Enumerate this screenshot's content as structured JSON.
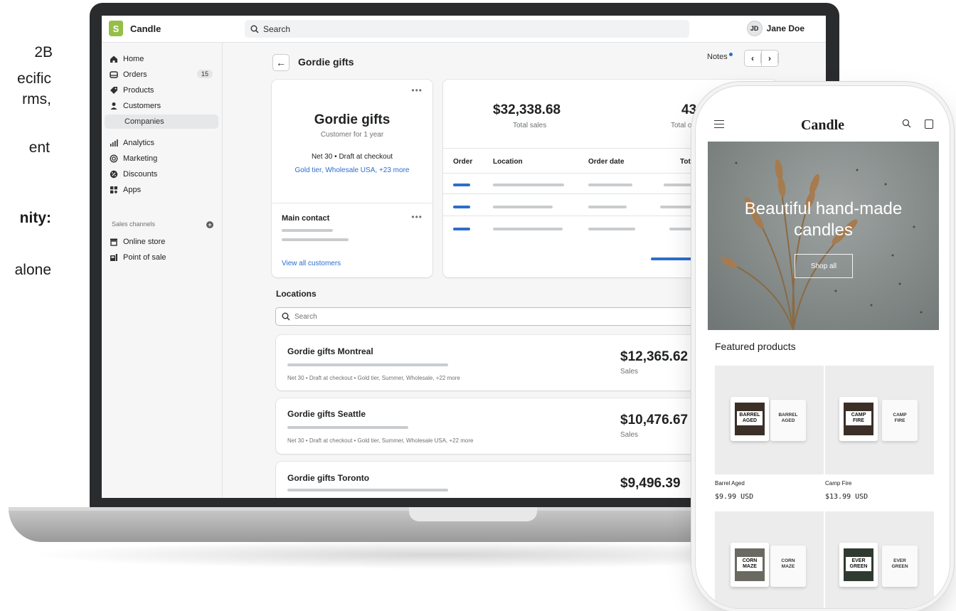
{
  "side_copy": {
    "line1": "2B",
    "line2": "ecific",
    "line3": "rms,",
    "line4": "ent",
    "line5": "nity:",
    "line6": "alone"
  },
  "app": {
    "brand": "Candle",
    "search_placeholder": "Search",
    "user_initials": "JD",
    "user_name": "Jane Doe"
  },
  "sidebar": {
    "items": [
      {
        "label": "Home",
        "icon": "home-icon"
      },
      {
        "label": "Orders",
        "icon": "orders-icon",
        "badge": "15"
      },
      {
        "label": "Products",
        "icon": "tag-icon"
      },
      {
        "label": "Customers",
        "icon": "person-icon"
      },
      {
        "label": "Companies",
        "icon": ""
      },
      {
        "label": "Analytics",
        "icon": "chart-icon"
      },
      {
        "label": "Marketing",
        "icon": "target-icon"
      },
      {
        "label": "Discounts",
        "icon": "discount-icon"
      },
      {
        "label": "Apps",
        "icon": "apps-icon"
      }
    ],
    "sales_channels_title": "Sales channels",
    "channels": [
      {
        "label": "Online store",
        "icon": "store-icon"
      },
      {
        "label": "Point of sale",
        "icon": "pos-icon"
      }
    ]
  },
  "page": {
    "title": "Gordie gifts",
    "notes_label": "Notes"
  },
  "company_card": {
    "name": "Gordie gifts",
    "tenure": "Customer for 1 year",
    "terms": "Net 30 • Draft at checkout",
    "tag1": "Gold tier",
    "tag2": "Wholesale USA",
    "tag_more": "+23 more",
    "main_contact": "Main contact",
    "view_all": "View all customers"
  },
  "stats_card": {
    "total_sales": "$32,338.68",
    "total_sales_label": "Total sales",
    "total_orders": "43",
    "total_orders_label": "Total ord",
    "columns": [
      "Order",
      "Location",
      "Order date",
      "Total"
    ]
  },
  "locations": {
    "title": "Locations",
    "search_placeholder": "Search",
    "items": [
      {
        "name": "Gordie gifts Montreal",
        "meta": "Net 30 • Draft at checkout • Gold tier, Summer, Wholesale, +22 more",
        "amount": "$12,365.62",
        "amount_label": "Sales"
      },
      {
        "name": "Gordie gifts Seattle",
        "meta": "Net 30 • Draft at checkout • Gold tier, Summer, Wholesale USA, +22 more",
        "amount": "$10,476.67",
        "amount_label": "Sales"
      },
      {
        "name": "Gordie gifts Toronto",
        "meta": "",
        "amount": "$9,496.39",
        "amount_label": ""
      }
    ]
  },
  "storefront": {
    "brand": "Candle",
    "hero_title_line1": "Beautiful hand-made",
    "hero_title_line2": "candles",
    "hero_button": "Shop all",
    "featured_title": "Featured products",
    "products": [
      {
        "name": "Barrel Aged",
        "price": "$9.99 USD",
        "label_line1": "BARREL",
        "label_line2": "AGED"
      },
      {
        "name": "Camp Fire",
        "price": "$13.99 USD",
        "label_line1": "CAMP",
        "label_line2": "FIRE"
      },
      {
        "name": "",
        "price": "",
        "label_line1": "CORN",
        "label_line2": "MAZE"
      },
      {
        "name": "",
        "price": "",
        "label_line1": "EVER",
        "label_line2": "GREEN"
      }
    ]
  },
  "colors": {
    "accent_blue": "#2c6ecb",
    "brand_green": "#95bf47",
    "app_bg": "#f6f6f7"
  }
}
